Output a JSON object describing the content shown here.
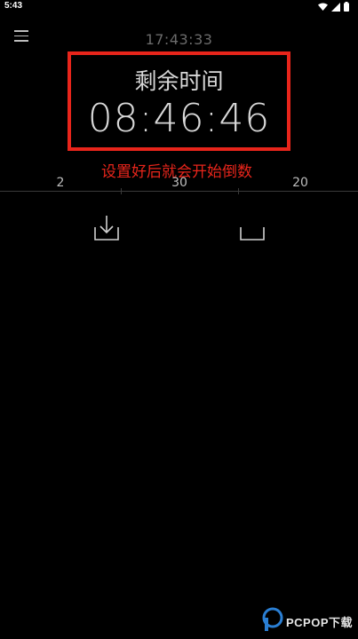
{
  "status_bar": {
    "time": "5:43",
    "icons": [
      "wifi-icon",
      "signal-icon",
      "battery-icon"
    ]
  },
  "header": {
    "menu_icon": "hamburger-menu-icon",
    "clock": "17:43:33"
  },
  "timer": {
    "label": "剩余时间",
    "countdown": "08:46:46"
  },
  "annotation": {
    "hint": "设置好后就会开始倒数",
    "color": "#e8251b"
  },
  "picker": {
    "values": [
      "2",
      "30",
      "20"
    ]
  },
  "actions": {
    "icons": [
      "download-icon",
      "stop-icon"
    ]
  },
  "watermark": {
    "text": "PCPOP下载"
  }
}
